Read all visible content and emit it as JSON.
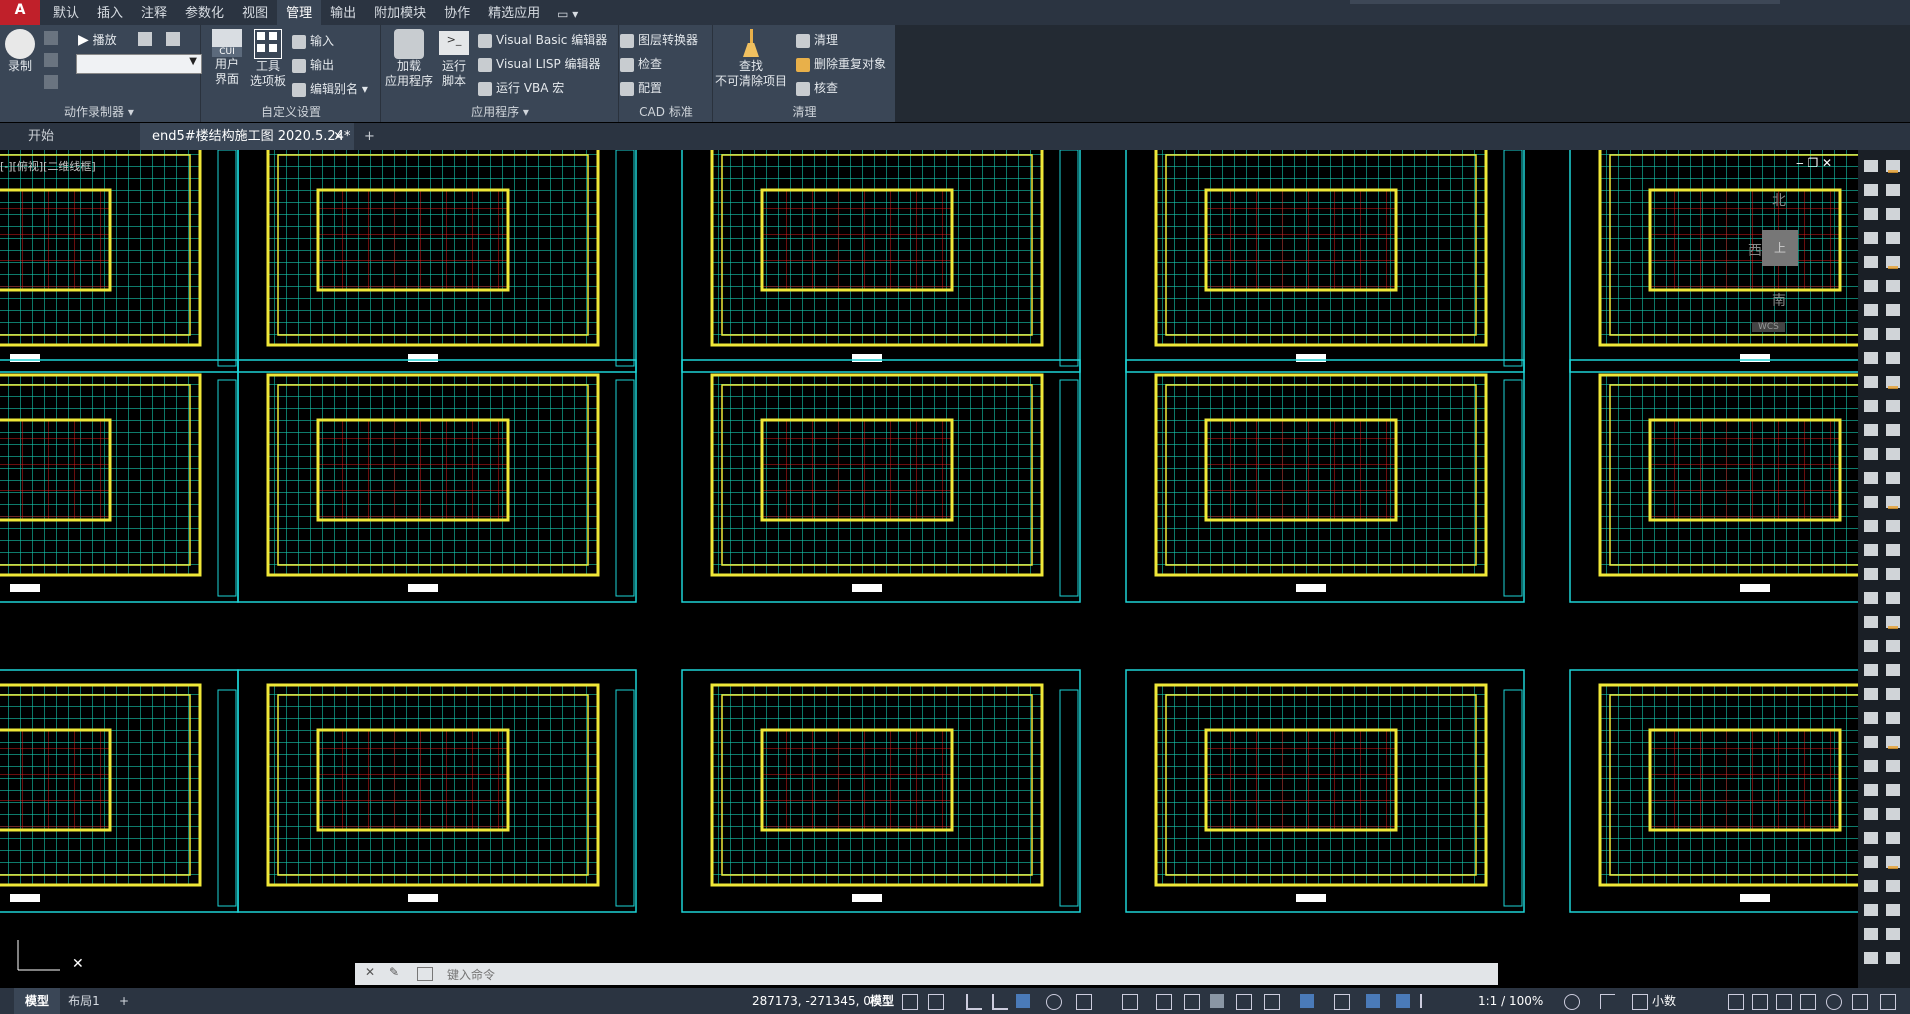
{
  "app": {
    "logo": "A"
  },
  "menu": {
    "tabs": [
      "默认",
      "插入",
      "注释",
      "参数化",
      "视图",
      "管理",
      "输出",
      "附加模块",
      "协作",
      "精选应用"
    ],
    "active_tab": "管理",
    "extra": "▭ ▾"
  },
  "ribbon": {
    "action_recorder": {
      "title": "动作录制器 ▾",
      "record": "录制",
      "play": "播放",
      "dropdown_value": ""
    },
    "custom_settings": {
      "title": "自定义设置",
      "user_interface": "用户\n界面",
      "cui_badge": "CUI",
      "tool_palettes": "工具\n选项板",
      "import": "输入",
      "export": "输出",
      "edit_aliases": "编辑别名 ▾"
    },
    "applications": {
      "title": "应用程序 ▾",
      "load_app": "加载\n应用程序",
      "run_script": "运行\n脚本",
      "vb_editor": "Visual Basic 编辑器",
      "lisp_editor": "Visual LISP 编辑器",
      "run_vba": "运行 VBA 宏"
    },
    "cad_standards": {
      "title": "CAD 标准",
      "layer_translator": "图层转换器",
      "check": "检查",
      "configure": "配置"
    },
    "cleanup": {
      "title": "清理",
      "find_non_purgeable": "查找\n不可清除项目",
      "purge": "清理",
      "overkill": "删除重复对象",
      "audit": "核查"
    }
  },
  "doc_tabs": {
    "start": "开始",
    "active": "end5#楼结构施工图 2020.5.24*",
    "close": "×",
    "add": "+"
  },
  "viewport": {
    "label": "[-][俯视][二维线框]",
    "controls": "‒ ❐ ✕"
  },
  "compass": {
    "north": "北",
    "south": "南",
    "west": "西",
    "center": "上",
    "wcs": "WCS"
  },
  "command": {
    "placeholder": "键入命令",
    "close": "✕",
    "settings": "✎"
  },
  "status": {
    "model_tab": "模型",
    "layout_tab": "布局1",
    "add_tab": "+",
    "coordinates": "287173, -271345, 0",
    "model_space": "模型",
    "annotation_scale": "1:1 / 100%",
    "units": "小数"
  },
  "colors": {
    "menubar": "#2b3441",
    "ribbon": "#3a4656",
    "frame": "#1dd3d6",
    "wall": "#f0e838",
    "grid": "#e02020",
    "detail": "#19e6c8"
  }
}
